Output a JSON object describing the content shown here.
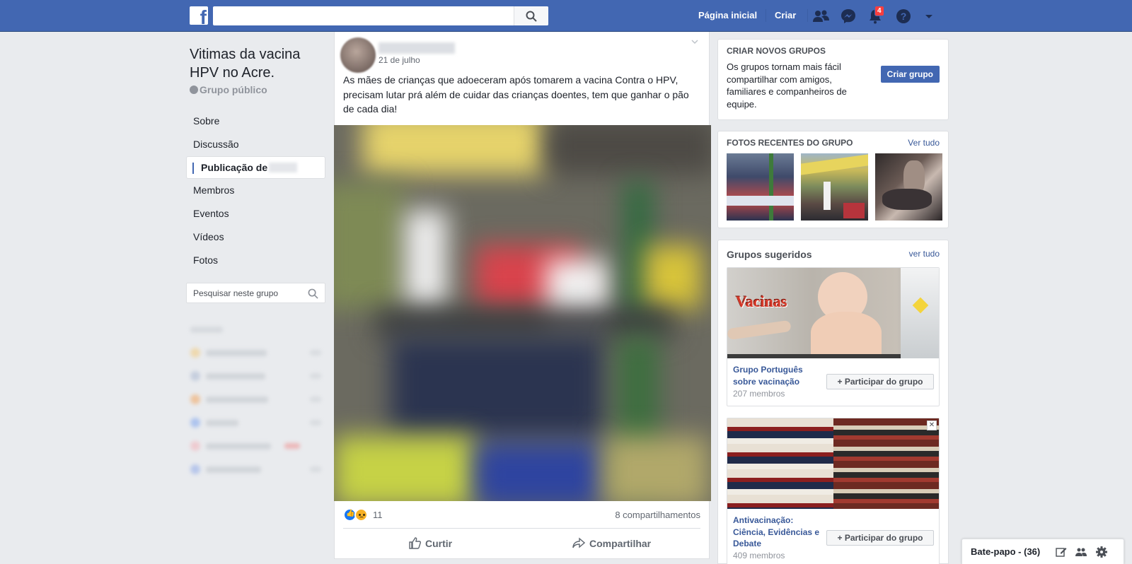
{
  "topbar": {
    "logo_letter": "f",
    "search_placeholder": "",
    "nav_home": "Página inicial",
    "nav_create": "Criar",
    "notifications_count": "4",
    "colors": {
      "bar": "#4267b2",
      "badge": "#fa3e3e"
    },
    "icons": [
      "friend-requests-icon",
      "messenger-icon",
      "notifications-icon",
      "help-icon",
      "account-menu-icon"
    ]
  },
  "group": {
    "title": "Vitimas da vacina HPV no Acre.",
    "privacy": "Grupo público"
  },
  "leftnav": {
    "items": [
      {
        "label": "Sobre"
      },
      {
        "label": "Discussão"
      },
      {
        "label": "Publicação de",
        "active": true
      },
      {
        "label": "Membros"
      },
      {
        "label": "Eventos"
      },
      {
        "label": "Vídeos"
      },
      {
        "label": "Fotos"
      }
    ],
    "search_placeholder": "Pesquisar neste grupo"
  },
  "post": {
    "date": "21 de julho",
    "text": "As mães de crianças que adoeceram após tomarem a vacina Contra o HPV, precisam lutar prá além de cuidar das crianças doentes, tem que ganhar o pão de cada dia!",
    "reaction_count": "11",
    "shares": "8 compartilhamentos",
    "like_action": "Curtir",
    "share_action": "Compartilhar"
  },
  "create_groups": {
    "heading": "CRIAR NOVOS GRUPOS",
    "description": "Os grupos tornam mais fácil compartilhar com amigos, familiares e companheiros de equipe.",
    "button": "Criar grupo"
  },
  "recent_photos": {
    "heading": "FOTOS RECENTES DO GRUPO",
    "see_all": "Ver tudo"
  },
  "suggested": {
    "heading": "Grupos sugeridos",
    "see_all": "ver tudo",
    "groups": [
      {
        "name": "Grupo Português sobre vacinação",
        "members": "207 membros",
        "join": "Participar do grupo",
        "image_text": "Vacinas"
      },
      {
        "name": "Antivacinação: Ciência, Evidências e Debate",
        "members": "409 membros",
        "join": "Participar do grupo",
        "close": "✕"
      }
    ]
  },
  "chat": {
    "label": "Bate-papo - (36)"
  }
}
